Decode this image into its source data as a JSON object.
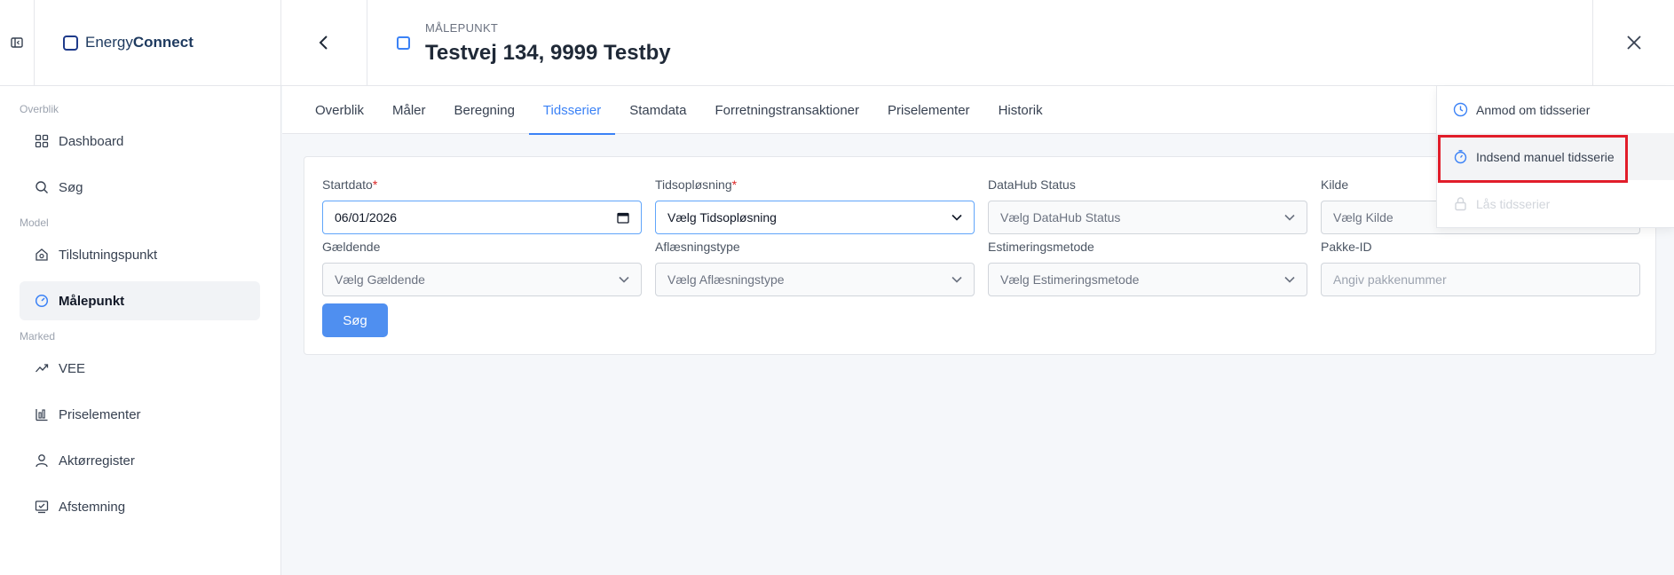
{
  "app": {
    "brand_light": "Energy",
    "brand_bold": "Connect"
  },
  "header": {
    "kicker": "MÅLEPUNKT",
    "title": "Testvej 134, 9999 Testby"
  },
  "sidebar": {
    "sections": [
      {
        "label": "Overblik",
        "items": [
          {
            "label": "Dashboard",
            "icon": "grid-icon"
          },
          {
            "label": "Søg",
            "icon": "search-icon"
          }
        ]
      },
      {
        "label": "Model",
        "items": [
          {
            "label": "Tilslutningspunkt",
            "icon": "house-icon"
          },
          {
            "label": "Målepunkt",
            "icon": "gauge-icon",
            "active": true
          }
        ]
      },
      {
        "label": "Marked",
        "items": [
          {
            "label": "VEE",
            "icon": "trend-icon"
          },
          {
            "label": "Priselementer",
            "icon": "chart-bars-icon"
          },
          {
            "label": "Aktørregister",
            "icon": "user-icon"
          },
          {
            "label": "Afstemning",
            "icon": "check-monitor-icon"
          }
        ]
      }
    ]
  },
  "tabs": [
    "Overblik",
    "Måler",
    "Beregning",
    "Tidsserier",
    "Stamdata",
    "Forretningstransaktioner",
    "Priselementer",
    "Historik"
  ],
  "active_tab": "Tidsserier",
  "form": {
    "startdato": {
      "label": "Startdato",
      "value": "06/01/2026"
    },
    "tidsoplosning": {
      "label": "Tidsopløsning",
      "value": "Vælg Tidsopløsning"
    },
    "datahub": {
      "label": "DataHub Status",
      "placeholder": "Vælg DataHub Status"
    },
    "kilde": {
      "label": "Kilde",
      "placeholder": "Vælg Kilde"
    },
    "gaeldende": {
      "label": "Gældende",
      "placeholder": "Vælg Gældende"
    },
    "aflaesning": {
      "label": "Aflæsningstype",
      "placeholder": "Vælg Aflæsningstype"
    },
    "estimering": {
      "label": "Estimeringsmetode",
      "placeholder": "Vælg Estimeringsmetode"
    },
    "pakke": {
      "label": "Pakke-ID",
      "placeholder": "Angiv pakkenummer"
    },
    "required_mark": "*",
    "search_label": "Søg"
  },
  "menu": {
    "items": [
      {
        "label": "Anmod om tidsserier",
        "icon": "clock-icon"
      },
      {
        "label": "Indsend manuel tidsserie",
        "icon": "stopwatch-icon"
      },
      {
        "label": "Lås tidsserier",
        "icon": "lock-icon"
      }
    ]
  },
  "colors": {
    "accent": "#3b82f6",
    "highlight_border": "#e11d2a"
  }
}
